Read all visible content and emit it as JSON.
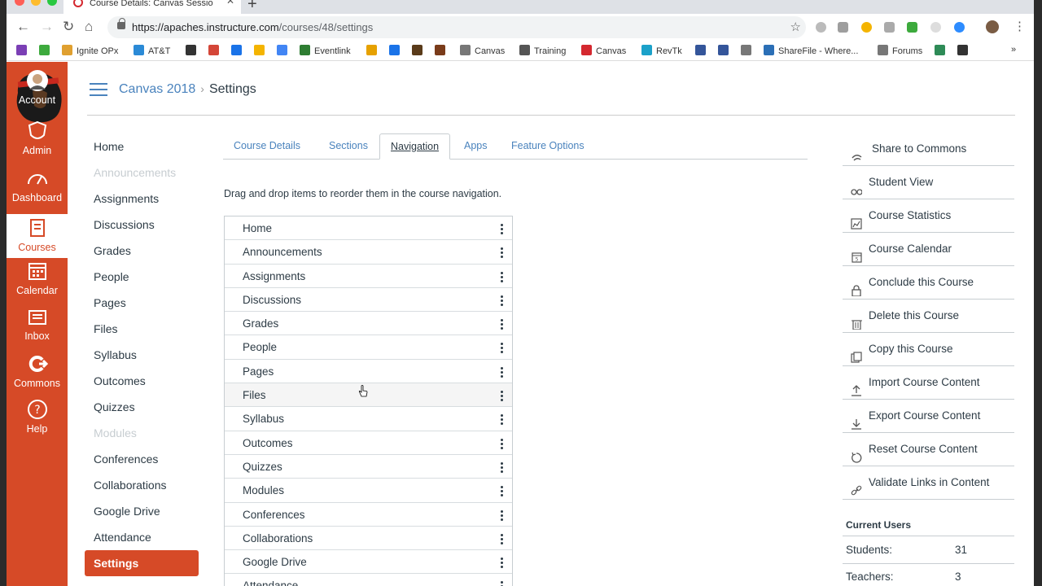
{
  "browser": {
    "tab_title": "Course Details: Canvas Sessio",
    "url_host": "https://apaches.instructure.com",
    "url_path": "/courses/48/settings"
  },
  "bookmarks": [
    {
      "label": "",
      "color": "#7b3fb5"
    },
    {
      "label": "",
      "color": "#3daa3d"
    },
    {
      "label": "Ignite OPx",
      "color": "#e0a030"
    },
    {
      "label": "AT&T",
      "color": "#2b8ad6"
    },
    {
      "label": "",
      "color": "#333333"
    },
    {
      "label": "",
      "color": "#d44638"
    },
    {
      "label": "",
      "color": "#1a73e8"
    },
    {
      "label": "",
      "color": "#f4b400"
    },
    {
      "label": "",
      "color": "#4285f4"
    },
    {
      "label": "Eventlink",
      "color": "#2e7d32"
    },
    {
      "label": "",
      "color": "#e6a100"
    },
    {
      "label": "",
      "color": "#1a73e8"
    },
    {
      "label": "",
      "color": "#5a3b1a"
    },
    {
      "label": "",
      "color": "#7a3b1a"
    },
    {
      "label": "Canvas",
      "color": "#777777"
    },
    {
      "label": "Training",
      "color": "#555555"
    },
    {
      "label": "Canvas",
      "color": "#d4282f"
    },
    {
      "label": "RevTk",
      "color": "#1ba1c9"
    },
    {
      "label": "",
      "color": "#34559a"
    },
    {
      "label": "",
      "color": "#34559a"
    },
    {
      "label": "",
      "color": "#777777"
    },
    {
      "label": "ShareFile - Where...",
      "color": "#2b6fb6"
    },
    {
      "label": "Forums",
      "color": "#777777"
    },
    {
      "label": "",
      "color": "#2e8b57"
    },
    {
      "label": "",
      "color": "#333333"
    }
  ],
  "global_nav": {
    "items": [
      {
        "label": "Account",
        "icon": "avatar-icon"
      },
      {
        "label": "Admin",
        "icon": "shield-icon"
      },
      {
        "label": "Dashboard",
        "icon": "dashboard-icon"
      },
      {
        "label": "Courses",
        "icon": "book-icon"
      },
      {
        "label": "Calendar",
        "icon": "calendar-icon"
      },
      {
        "label": "Inbox",
        "icon": "inbox-icon"
      },
      {
        "label": "Commons",
        "icon": "commons-icon"
      },
      {
        "label": "Help",
        "icon": "help-icon"
      }
    ]
  },
  "breadcrumb": {
    "course": "Canvas 2018",
    "page": "Settings"
  },
  "course_nav": [
    {
      "label": "Home",
      "state": "normal"
    },
    {
      "label": "Announcements",
      "state": "muted"
    },
    {
      "label": "Assignments",
      "state": "normal"
    },
    {
      "label": "Discussions",
      "state": "normal"
    },
    {
      "label": "Grades",
      "state": "normal"
    },
    {
      "label": "People",
      "state": "normal"
    },
    {
      "label": "Pages",
      "state": "normal"
    },
    {
      "label": "Files",
      "state": "normal"
    },
    {
      "label": "Syllabus",
      "state": "normal"
    },
    {
      "label": "Outcomes",
      "state": "normal"
    },
    {
      "label": "Quizzes",
      "state": "normal"
    },
    {
      "label": "Modules",
      "state": "muted"
    },
    {
      "label": "Conferences",
      "state": "normal"
    },
    {
      "label": "Collaborations",
      "state": "normal"
    },
    {
      "label": "Google Drive",
      "state": "normal"
    },
    {
      "label": "Attendance",
      "state": "normal"
    },
    {
      "label": "Settings",
      "state": "active"
    }
  ],
  "settings_tabs": [
    "Course Details",
    "Sections",
    "Navigation",
    "Apps",
    "Feature Options"
  ],
  "instructions": "Drag and drop items to reorder them in the course navigation.",
  "nav_items": [
    "Home",
    "Announcements",
    "Assignments",
    "Discussions",
    "Grades",
    "People",
    "Pages",
    "Files",
    "Syllabus",
    "Outcomes",
    "Quizzes",
    "Modules",
    "Conferences",
    "Collaborations",
    "Google Drive",
    "Attendance"
  ],
  "sidebar_actions": [
    {
      "label": "Share to Commons",
      "icon": "share-icon"
    },
    {
      "label": "Student View",
      "icon": "glasses-icon"
    },
    {
      "label": "Course Statistics",
      "icon": "stats-icon"
    },
    {
      "label": "Course Calendar",
      "icon": "calendar-icon"
    },
    {
      "label": "Conclude this Course",
      "icon": "lock-icon"
    },
    {
      "label": "Delete this Course",
      "icon": "trash-icon"
    },
    {
      "label": "Copy this Course",
      "icon": "copy-icon"
    },
    {
      "label": "Import Course Content",
      "icon": "upload-icon"
    },
    {
      "label": "Export Course Content",
      "icon": "download-icon"
    },
    {
      "label": "Reset Course Content",
      "icon": "reset-icon"
    },
    {
      "label": "Validate Links in Content",
      "icon": "link-icon"
    }
  ],
  "current_users": {
    "title": "Current Users",
    "rows": [
      {
        "label": "Students:",
        "value": "31"
      },
      {
        "label": "Teachers:",
        "value": "3"
      }
    ]
  },
  "colors": {
    "canvas_orange": "#d64a27",
    "link_blue": "#4a83bd",
    "text": "#2d3b45"
  }
}
